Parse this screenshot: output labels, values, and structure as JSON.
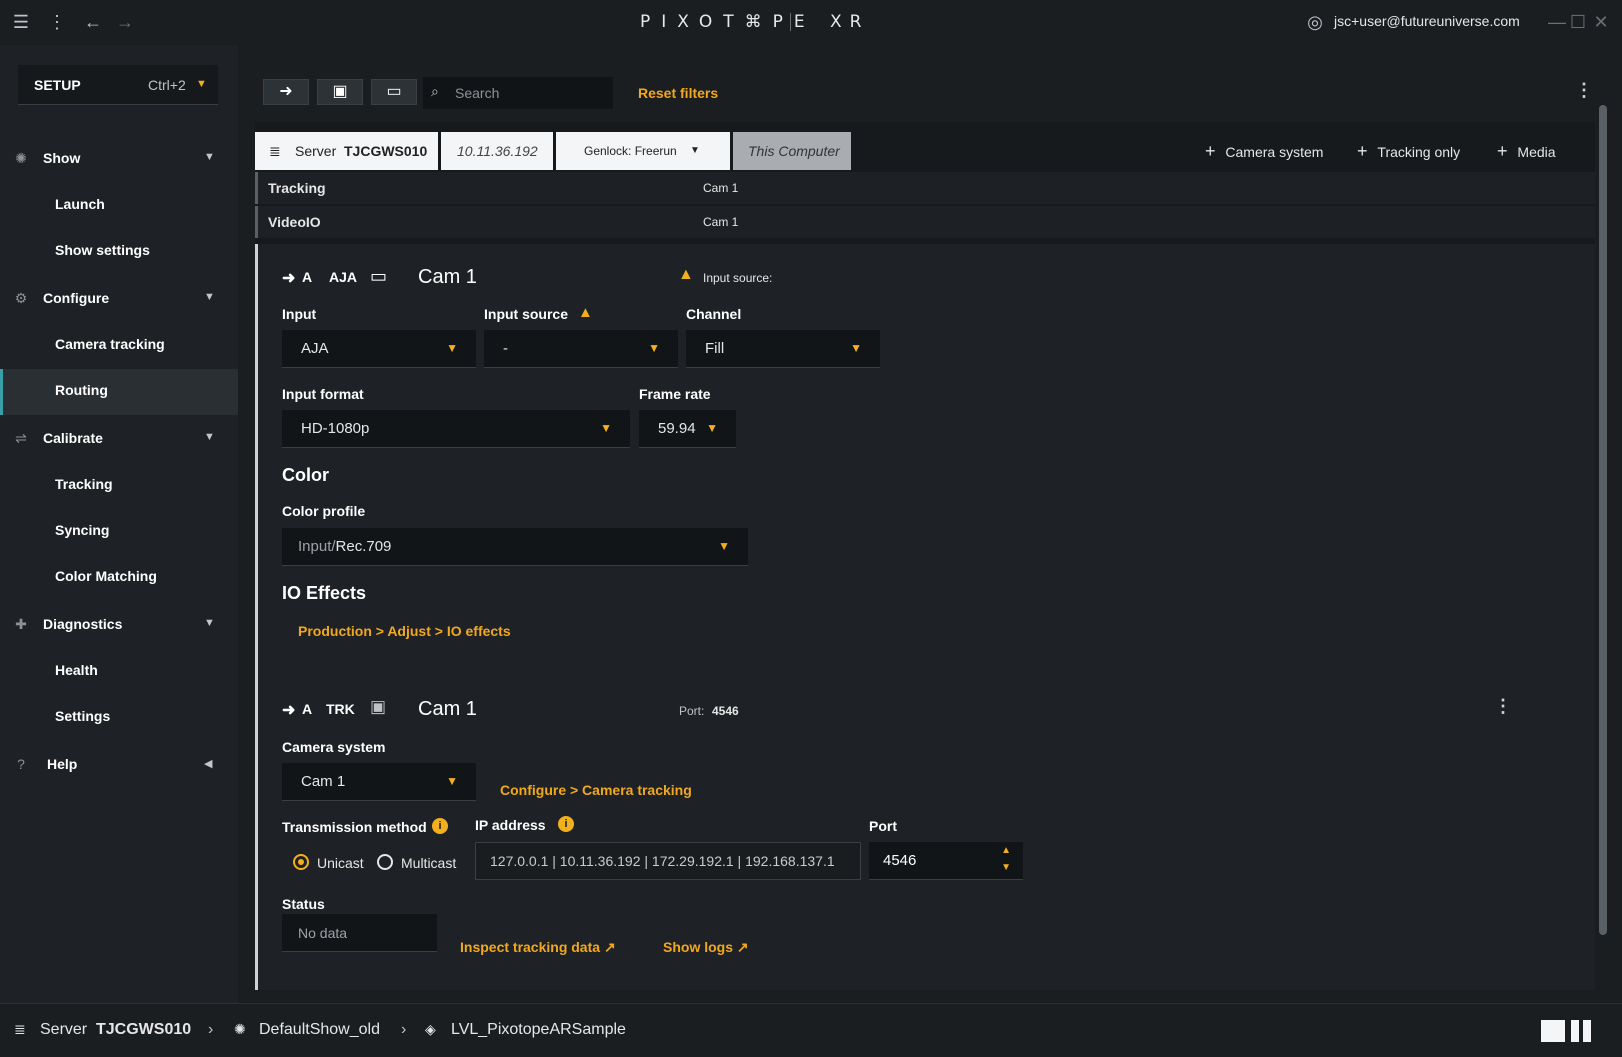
{
  "titlebar": {
    "logo": "PIXOT⌘PE",
    "product": "XR",
    "user_email": "jsc+user@futureuniverse.com"
  },
  "sidebar": {
    "mode_label": "SETUP",
    "mode_shortcut": "Ctrl+2",
    "groups": [
      {
        "label": "Show",
        "items": [
          "Launch",
          "Show settings"
        ]
      },
      {
        "label": "Configure",
        "items": [
          "Camera tracking",
          "Routing"
        ]
      },
      {
        "label": "Calibrate",
        "items": [
          "Tracking",
          "Syncing",
          "Color Matching"
        ]
      },
      {
        "label": "Diagnostics",
        "items": [
          "Health",
          "Settings"
        ]
      },
      {
        "label": "Help",
        "items": []
      }
    ],
    "active_item": "Routing"
  },
  "toolbar": {
    "search_placeholder": "Search",
    "reset_filters": "Reset filters"
  },
  "server": {
    "label": "Server",
    "name": "TJCGWS010",
    "ip": "10.11.36.192",
    "genlock": "Genlock: Freerun",
    "this_computer": "This Computer",
    "add_camera_system": "Camera system",
    "add_tracking_only": "Tracking only",
    "add_media": "Media"
  },
  "rows": [
    {
      "key": "Tracking",
      "value": "Cam 1"
    },
    {
      "key": "VideoIO",
      "value": "Cam 1"
    }
  ],
  "video_section": {
    "arrow_label": "A",
    "type": "AJA",
    "title": "Cam 1",
    "warning": "Input source:",
    "input_label": "Input",
    "input_value": "AJA",
    "input_source_label": "Input source",
    "input_source_value": "-",
    "channel_label": "Channel",
    "channel_value": "Fill",
    "input_format_label": "Input format",
    "input_format_value": "HD-1080p",
    "frame_rate_label": "Frame rate",
    "frame_rate_value": "59.94",
    "color_heading": "Color",
    "color_profile_label": "Color profile",
    "color_profile_prefix": "Input/",
    "color_profile_value": "Rec.709",
    "io_effects_heading": "IO Effects",
    "io_effects_link": "Production > Adjust > IO effects"
  },
  "tracking_section": {
    "arrow_label": "A",
    "type": "TRK",
    "title": "Cam 1",
    "port_label": "Port:",
    "port_value": "4546",
    "camera_system_label": "Camera system",
    "camera_system_value": "Cam 1",
    "configure_link": "Configure > Camera tracking",
    "transmission_label": "Transmission method",
    "unicast": "Unicast",
    "multicast": "Multicast",
    "ip_label": "IP address",
    "ip_value": "127.0.0.1 | 10.11.36.192 | 172.29.192.1 | 192.168.137.1",
    "port_field_label": "Port",
    "port_field_value": "4546",
    "status_label": "Status",
    "status_value": "No data",
    "inspect_link": "Inspect tracking data",
    "logs_link": "Show logs"
  },
  "statusbar": {
    "server_label": "Server",
    "server_name": "TJCGWS010",
    "show": "DefaultShow_old",
    "level": "LVL_PixotopeARSample"
  },
  "colors": {
    "accent": "#f2a81d",
    "active_border": "#3aa0a8"
  }
}
